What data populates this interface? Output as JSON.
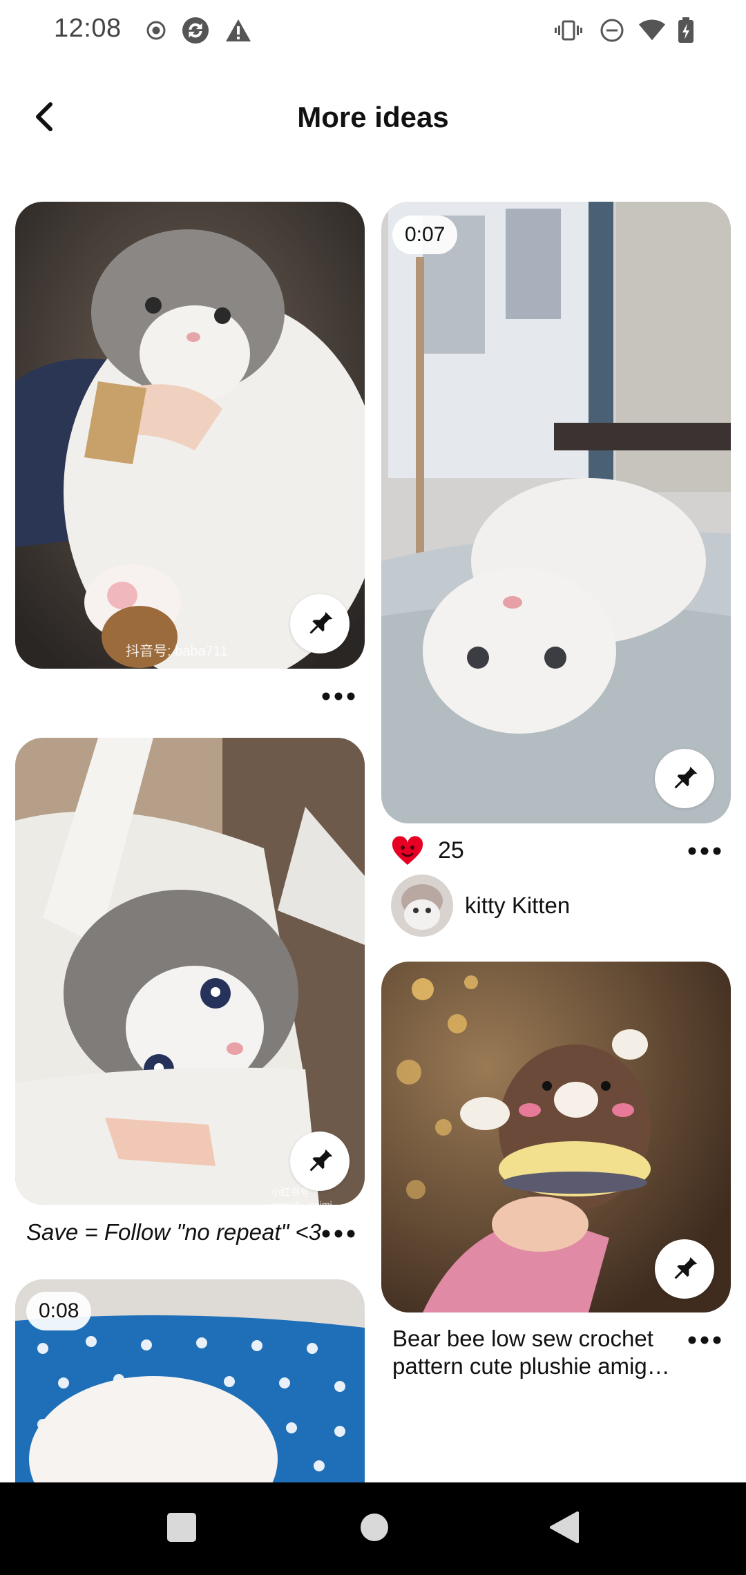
{
  "status_bar": {
    "time": "12:08",
    "left_icons": [
      "record-icon",
      "sync-icon",
      "warning-icon"
    ],
    "right_icons": [
      "vibrate-icon",
      "dnd-icon",
      "wifi-icon",
      "battery-charging-icon"
    ]
  },
  "header": {
    "title": "More ideas",
    "back_icon": "back-arrow-icon"
  },
  "feed": {
    "pins": [
      {
        "id": "cat-held",
        "image": "ragdoll cat being held",
        "watermark": "抖音号: baba711",
        "has_save_button": true
      },
      {
        "id": "cat-video-bed",
        "image": "white cat upside down on bed",
        "duration": "0:07",
        "likes": "25",
        "creator": "kitty Kitten",
        "has_save_button": true
      },
      {
        "id": "cat-in-bag",
        "image": "ragdoll kitten in tote bag",
        "watermark": "小红书号 grapefu_naimi",
        "caption": "Save = Follow \"no repeat\" <3",
        "has_save_button": true
      },
      {
        "id": "crochet-bee",
        "image": "crochet bear bee plushie",
        "caption": "Bear bee low sew crochet pattern cute plushie amig…",
        "has_save_button": true
      },
      {
        "id": "cat-video-blue",
        "image": "kitten on blue polka dot blanket",
        "duration": "0:08"
      }
    ]
  },
  "nav_bar": {
    "buttons": [
      "recents-square-icon",
      "home-circle-icon",
      "back-triangle-icon"
    ]
  },
  "colors": {
    "heart": "#e60023",
    "nav_bg": "#000000"
  }
}
